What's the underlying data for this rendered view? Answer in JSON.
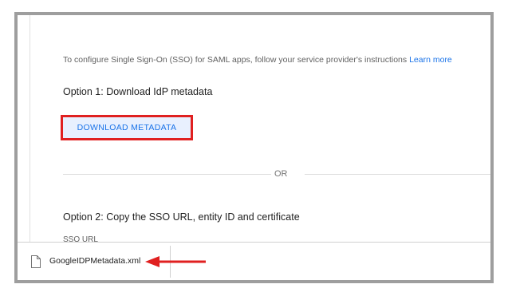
{
  "intro": {
    "text": "To configure Single Sign-On (SSO) for SAML apps, follow your service provider's instructions",
    "link": "Learn more"
  },
  "option1": {
    "heading": "Option 1: Download IdP metadata",
    "button_label": "DOWNLOAD METADATA"
  },
  "separator": "OR",
  "option2": {
    "heading": "Option 2: Copy the SSO URL, entity ID and certificate",
    "sso_url_label": "SSO URL"
  },
  "download_bar": {
    "file_name": "GoogleIDPMetadata.xml"
  },
  "colors": {
    "accent": "#1a73e8",
    "highlight": "#e02020",
    "button_bg": "#e8f0fe"
  },
  "icons": {
    "file": "file-icon",
    "arrow": "arrow-left-icon"
  }
}
